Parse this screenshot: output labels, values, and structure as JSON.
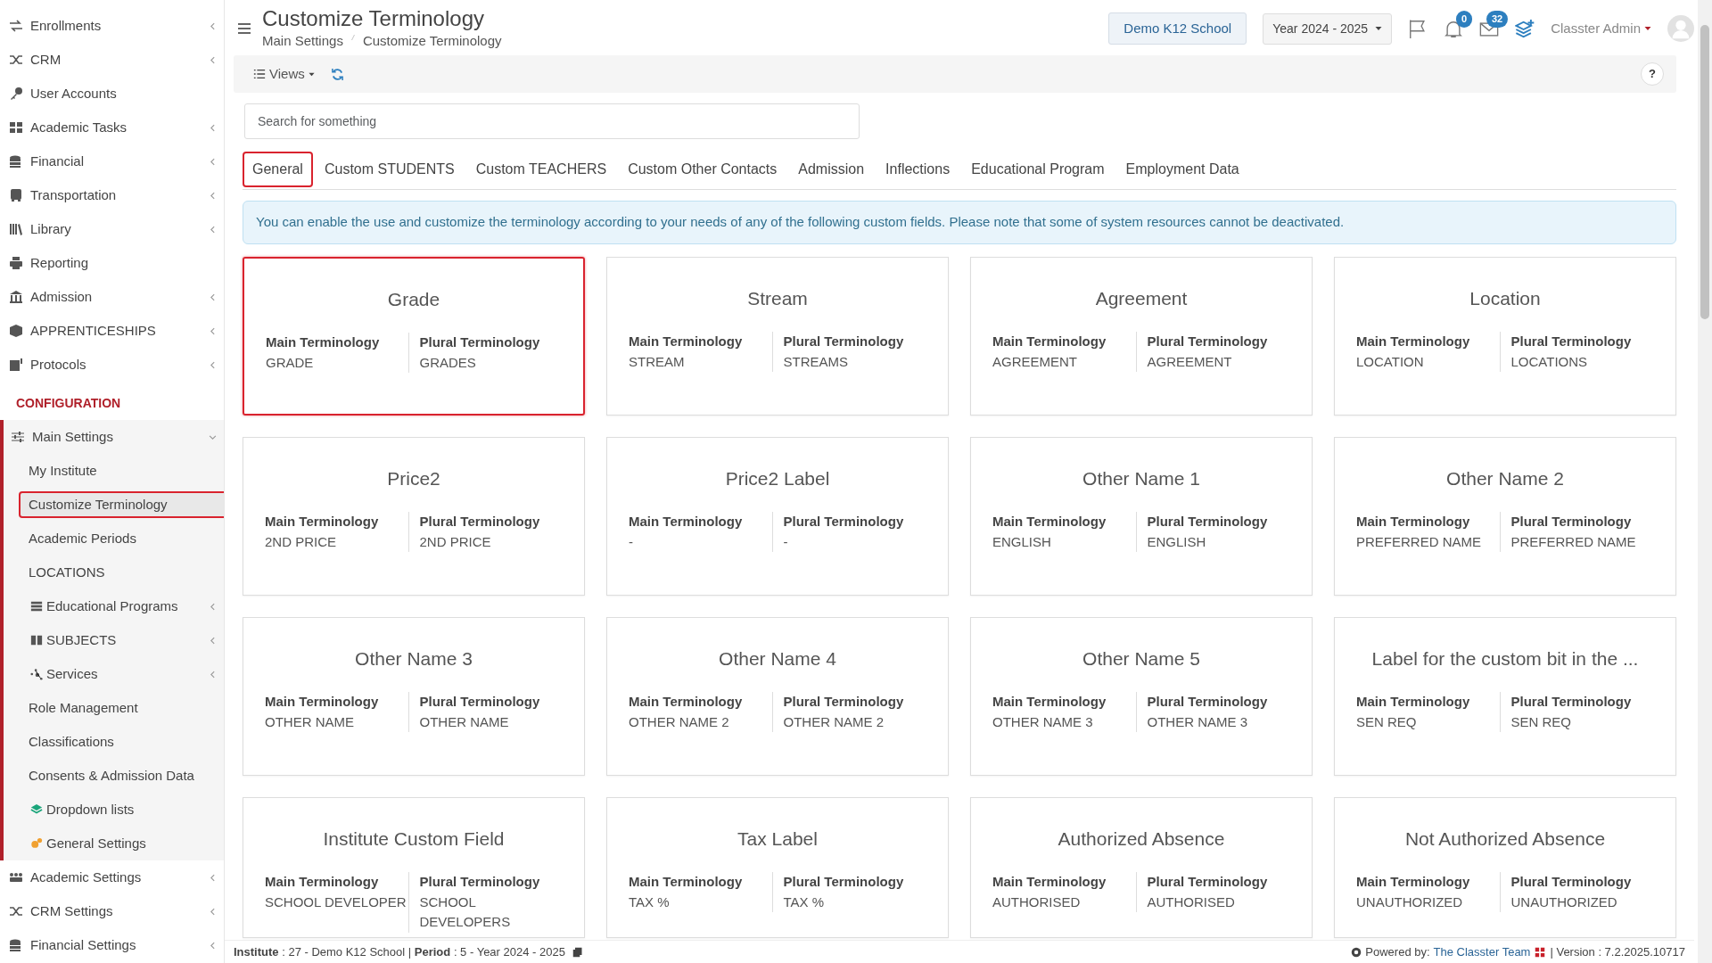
{
  "sidebar": {
    "items": [
      {
        "label": "Enrollments",
        "has_submenu": true
      },
      {
        "label": "CRM",
        "has_submenu": true
      },
      {
        "label": "User Accounts",
        "has_submenu": false
      },
      {
        "label": "Academic Tasks",
        "has_submenu": true
      },
      {
        "label": "Financial",
        "has_submenu": true
      },
      {
        "label": "Transportation",
        "has_submenu": true
      },
      {
        "label": "Library",
        "has_submenu": true
      },
      {
        "label": "Reporting",
        "has_submenu": false
      },
      {
        "label": "Admission",
        "has_submenu": true
      },
      {
        "label": "APPRENTICESHIPS",
        "has_submenu": true
      },
      {
        "label": "Protocols",
        "has_submenu": true
      }
    ],
    "section_title": "CONFIGURATION",
    "config_items": [
      {
        "label": "Main Settings",
        "has_submenu": true,
        "expanded": true,
        "children": [
          {
            "label": "My Institute",
            "selected": false,
            "has_submenu": false
          },
          {
            "label": "Customize Terminology",
            "selected": true,
            "has_submenu": false
          },
          {
            "label": "Academic Periods",
            "selected": false,
            "has_submenu": false
          },
          {
            "label": "LOCATIONS",
            "selected": false,
            "has_submenu": false
          },
          {
            "label": "Educational Programs",
            "selected": false,
            "has_submenu": true
          },
          {
            "label": "SUBJECTS",
            "selected": false,
            "has_submenu": true
          },
          {
            "label": "Services",
            "selected": false,
            "has_submenu": true
          },
          {
            "label": "Role Management",
            "selected": false,
            "has_submenu": false
          },
          {
            "label": "Classifications",
            "selected": false,
            "has_submenu": false
          },
          {
            "label": "Consents & Admission Data",
            "selected": false,
            "has_submenu": false
          },
          {
            "label": "Dropdown lists",
            "selected": false,
            "has_submenu": false
          },
          {
            "label": "General Settings",
            "selected": false,
            "has_submenu": false
          }
        ]
      },
      {
        "label": "Academic Settings",
        "has_submenu": true,
        "expanded": false
      },
      {
        "label": "CRM Settings",
        "has_submenu": true,
        "expanded": false
      },
      {
        "label": "Financial Settings",
        "has_submenu": true,
        "expanded": false
      }
    ]
  },
  "header": {
    "title": "Customize Terminology",
    "breadcrumb": [
      "Main Settings",
      "Customize Terminology"
    ],
    "school": "Demo K12 School",
    "year": "Year 2024 - 2025",
    "notifications": "0",
    "messages": "32",
    "user": "Classter Admin"
  },
  "toolbar": {
    "views": "Views",
    "help": "?"
  },
  "search": {
    "placeholder": "Search for something"
  },
  "tabs": [
    {
      "label": "General",
      "selected": true
    },
    {
      "label": "Custom STUDENTS",
      "selected": false
    },
    {
      "label": "Custom TEACHERS",
      "selected": false
    },
    {
      "label": "Custom Other Contacts",
      "selected": false
    },
    {
      "label": "Admission",
      "selected": false
    },
    {
      "label": "Inflections",
      "selected": false
    },
    {
      "label": "Educational Program",
      "selected": false
    },
    {
      "label": "Employment Data",
      "selected": false
    }
  ],
  "alert": "You can enable the use and customize the terminology according to your needs of any of the following custom fields. Please note that some of system resources cannot be deactivated.",
  "cards": [
    {
      "title": "Grade",
      "selected": true,
      "main_label": "Main Terminology",
      "main": "GRADE",
      "plural_label": "Plural Terminology",
      "plural": "GRADES"
    },
    {
      "title": "Stream",
      "selected": false,
      "main_label": "Main Terminology",
      "main": "STREAM",
      "plural_label": "Plural Terminology",
      "plural": "STREAMS"
    },
    {
      "title": "Agreement",
      "selected": false,
      "main_label": "Main Terminology",
      "main": "AGREEMENT",
      "plural_label": "Plural Terminology",
      "plural": "AGREEMENT"
    },
    {
      "title": "Location",
      "selected": false,
      "main_label": "Main Terminology",
      "main": "LOCATION",
      "plural_label": "Plural Terminology",
      "plural": "LOCATIONS"
    },
    {
      "title": "Price2",
      "selected": false,
      "main_label": "Main Terminology",
      "main": "2ND PRICE",
      "plural_label": "Plural Terminology",
      "plural": "2ND PRICE"
    },
    {
      "title": "Price2 Label",
      "selected": false,
      "main_label": "Main Terminology",
      "main": "-",
      "plural_label": "Plural Terminology",
      "plural": "-"
    },
    {
      "title": "Other Name 1",
      "selected": false,
      "main_label": "Main Terminology",
      "main": "ENGLISH",
      "plural_label": "Plural Terminology",
      "plural": "ENGLISH"
    },
    {
      "title": "Other Name 2",
      "selected": false,
      "main_label": "Main Terminology",
      "main": "PREFERRED NAME",
      "plural_label": "Plural Terminology",
      "plural": "PREFERRED NAME"
    },
    {
      "title": "Other Name 3",
      "selected": false,
      "main_label": "Main Terminology",
      "main": "OTHER NAME",
      "plural_label": "Plural Terminology",
      "plural": "OTHER NAME"
    },
    {
      "title": "Other Name 4",
      "selected": false,
      "main_label": "Main Terminology",
      "main": "OTHER NAME 2",
      "plural_label": "Plural Terminology",
      "plural": "OTHER NAME 2"
    },
    {
      "title": "Other Name 5",
      "selected": false,
      "main_label": "Main Terminology",
      "main": "OTHER NAME 3",
      "plural_label": "Plural Terminology",
      "plural": "OTHER NAME 3"
    },
    {
      "title": "Label for the custom bit in the ...",
      "selected": false,
      "main_label": "Main Terminology",
      "main": "SEN REQ",
      "plural_label": "Plural Terminology",
      "plural": "SEN REQ"
    },
    {
      "title": "Institute Custom Field",
      "selected": false,
      "main_label": "Main Terminology",
      "main": "SCHOOL DEVELOPER",
      "plural_label": "Plural Terminology",
      "plural": "SCHOOL DEVELOPERS"
    },
    {
      "title": "Tax Label",
      "selected": false,
      "main_label": "Main Terminology",
      "main": "TAX %",
      "plural_label": "Plural Terminology",
      "plural": "TAX %"
    },
    {
      "title": "Authorized Absence",
      "selected": false,
      "main_label": "Main Terminology",
      "main": "AUTHORISED",
      "plural_label": "Plural Terminology",
      "plural": "AUTHORISED"
    },
    {
      "title": "Not Authorized Absence",
      "selected": false,
      "main_label": "Main Terminology",
      "main": "UNAUTHORIZED",
      "plural_label": "Plural Terminology",
      "plural": "UNAUTHORIZED"
    }
  ],
  "footer": {
    "info": "**Institute** : 27 - Demo K12 School | **Period** : 5 - Year 2024 - 2025",
    "powered": "Powered by:",
    "team": "The Classter Team",
    "version": "| Version : 7.2.2025.10717"
  }
}
